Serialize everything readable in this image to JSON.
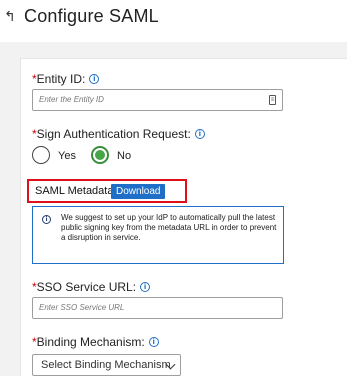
{
  "header": {
    "title": "Configure SAML"
  },
  "entity_id": {
    "label": "Entity ID:",
    "placeholder": "Enter the Entity ID"
  },
  "sign_auth": {
    "label": "Sign Authentication Request:",
    "options": [
      {
        "label": "Yes",
        "selected": false
      },
      {
        "label": "No",
        "selected": true
      }
    ]
  },
  "metadata": {
    "label": "SAML Metadata:",
    "button": "Download"
  },
  "notice": {
    "text": "We suggest to set up your IdP to automatically pull the latest public signing key from the metadata URL in order to prevent a disruption in service."
  },
  "sso_url": {
    "label": "SSO Service URL:",
    "placeholder": "Enter SSO Service URL"
  },
  "binding": {
    "label": "Binding Mechanism:",
    "value": "Select Binding Mechanism"
  },
  "colors": {
    "accent": "#1f6fc9",
    "required": "#d20000",
    "highlight": "#e0101a",
    "radio_selected": "#46a546"
  }
}
